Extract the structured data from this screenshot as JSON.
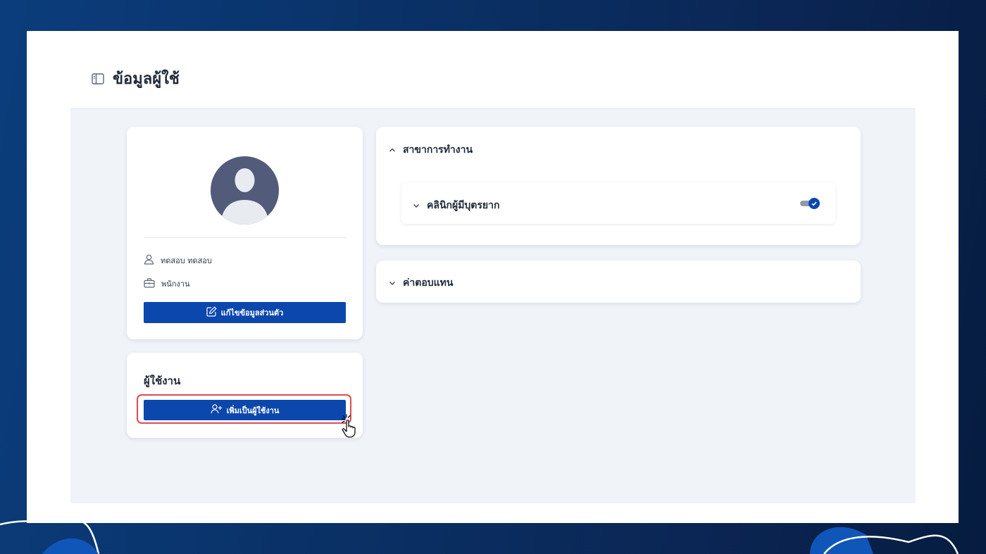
{
  "page": {
    "title": "ข้อมูลผู้ใช้",
    "header_icon": "sidebar-panel-icon"
  },
  "profile": {
    "avatar_icon": "user-avatar-icon",
    "name": "ทดสอบ ทดสอบ",
    "name_icon": "user-icon",
    "role": "พนักงาน",
    "role_icon": "briefcase-icon",
    "edit_button_label": "แก้ไขข้อมูลส่วนตัว",
    "edit_button_icon": "edit-icon"
  },
  "user_section": {
    "title": "ผู้ใช้งาน",
    "add_button_label": "เพิ่มเป็นผู้ใช้งาน",
    "add_button_icon": "user-plus-icon"
  },
  "branch_section": {
    "title": "สาขาการทำงาน",
    "expanded": true,
    "items": [
      {
        "label": "คลินิกผู้มีบุตรยาก",
        "enabled": true
      }
    ]
  },
  "compensation_section": {
    "title": "ค่าตอบแทน",
    "expanded": false
  },
  "colors": {
    "primary": "#0b47ad",
    "highlight": "#e5484d",
    "background": "#0b2553"
  }
}
